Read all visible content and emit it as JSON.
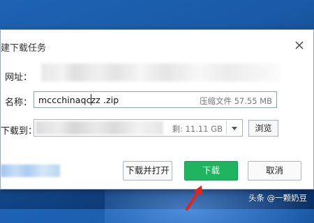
{
  "dialog": {
    "title": "建下载任务",
    "url_label": "网址：",
    "name_label": "名称：",
    "path_label": "下载到：",
    "name_value": "mccchinaqczz .zip",
    "file_info": "压缩文件 57.55 MB",
    "free_space": "剩: 11.11 GB",
    "browse_label": "浏览",
    "buttons": {
      "download_and_open": "下载并打开",
      "download": "下载",
      "cancel": "取消"
    }
  },
  "watermark": "头条 @一颗奶豆",
  "icons": {
    "close": "close-icon",
    "dropdown": "chevron-down-icon",
    "annotation_arrow": "red-arrow"
  },
  "colors": {
    "primary_button": "#1fb45f",
    "annotation_arrow": "#e0251b"
  }
}
